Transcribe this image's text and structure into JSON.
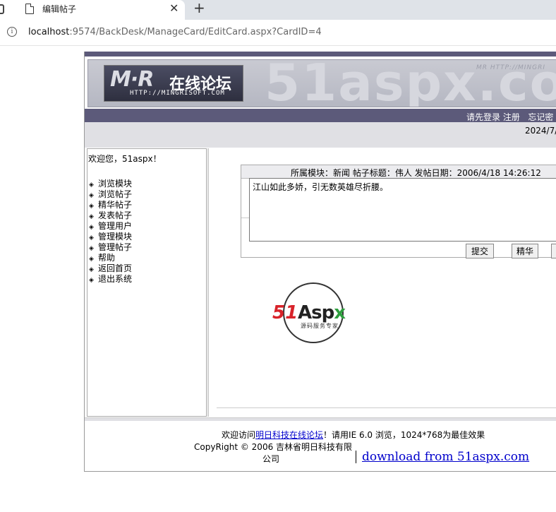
{
  "browser": {
    "tab_title": "编辑帖子",
    "url_host": "localhost",
    "url_rest": ":9574/BackDesk/ManageCard/EditCard.aspx?CardID=4"
  },
  "banner": {
    "logo_mr": "M·R",
    "logo_cn": "在线论坛",
    "logo_url": "HTTP://MINGRISOFT.COM",
    "watermark": "51aspx.com",
    "tag": "MR HTTP://MINGRI"
  },
  "nav": {
    "login": "请先登录",
    "register": "注册",
    "forgot": "忘记密",
    "date": "2024/7/"
  },
  "sidebar": {
    "welcome": "欢迎您，51aspx！",
    "items": [
      {
        "label": "浏览模块"
      },
      {
        "label": "浏览帖子"
      },
      {
        "label": "精华帖子"
      },
      {
        "label": "发表帖子"
      },
      {
        "label": "管理用户"
      },
      {
        "label": "管理模块"
      },
      {
        "label": "管理帖子"
      },
      {
        "label": "帮助"
      },
      {
        "label": "返回首页"
      },
      {
        "label": "退出系统"
      }
    ],
    "bullet": "◈"
  },
  "post": {
    "header": "所属模块：新闻 帖子标题：伟人 发帖日期：2006/4/18 14:26:12",
    "content": "江山如此多娇，引无数英雄尽折腰。",
    "submit_label": "提交",
    "elite_label": "精华",
    "third_label": ""
  },
  "emblem": {
    "part1": "51",
    "part2": "Asp",
    "part3": "x",
    "subtitle": "源码服务专家"
  },
  "footer": {
    "welcome_prefix": "欢迎访问",
    "site_link": "明日科技在线论坛",
    "welcome_suffix": "！请用IE 6.0 浏览，1024*768为最佳效果",
    "copyright": "CopyRight © 2006 吉林省明日科技有限",
    "company_suffix": "公司",
    "download": "download from 51aspx.com"
  }
}
